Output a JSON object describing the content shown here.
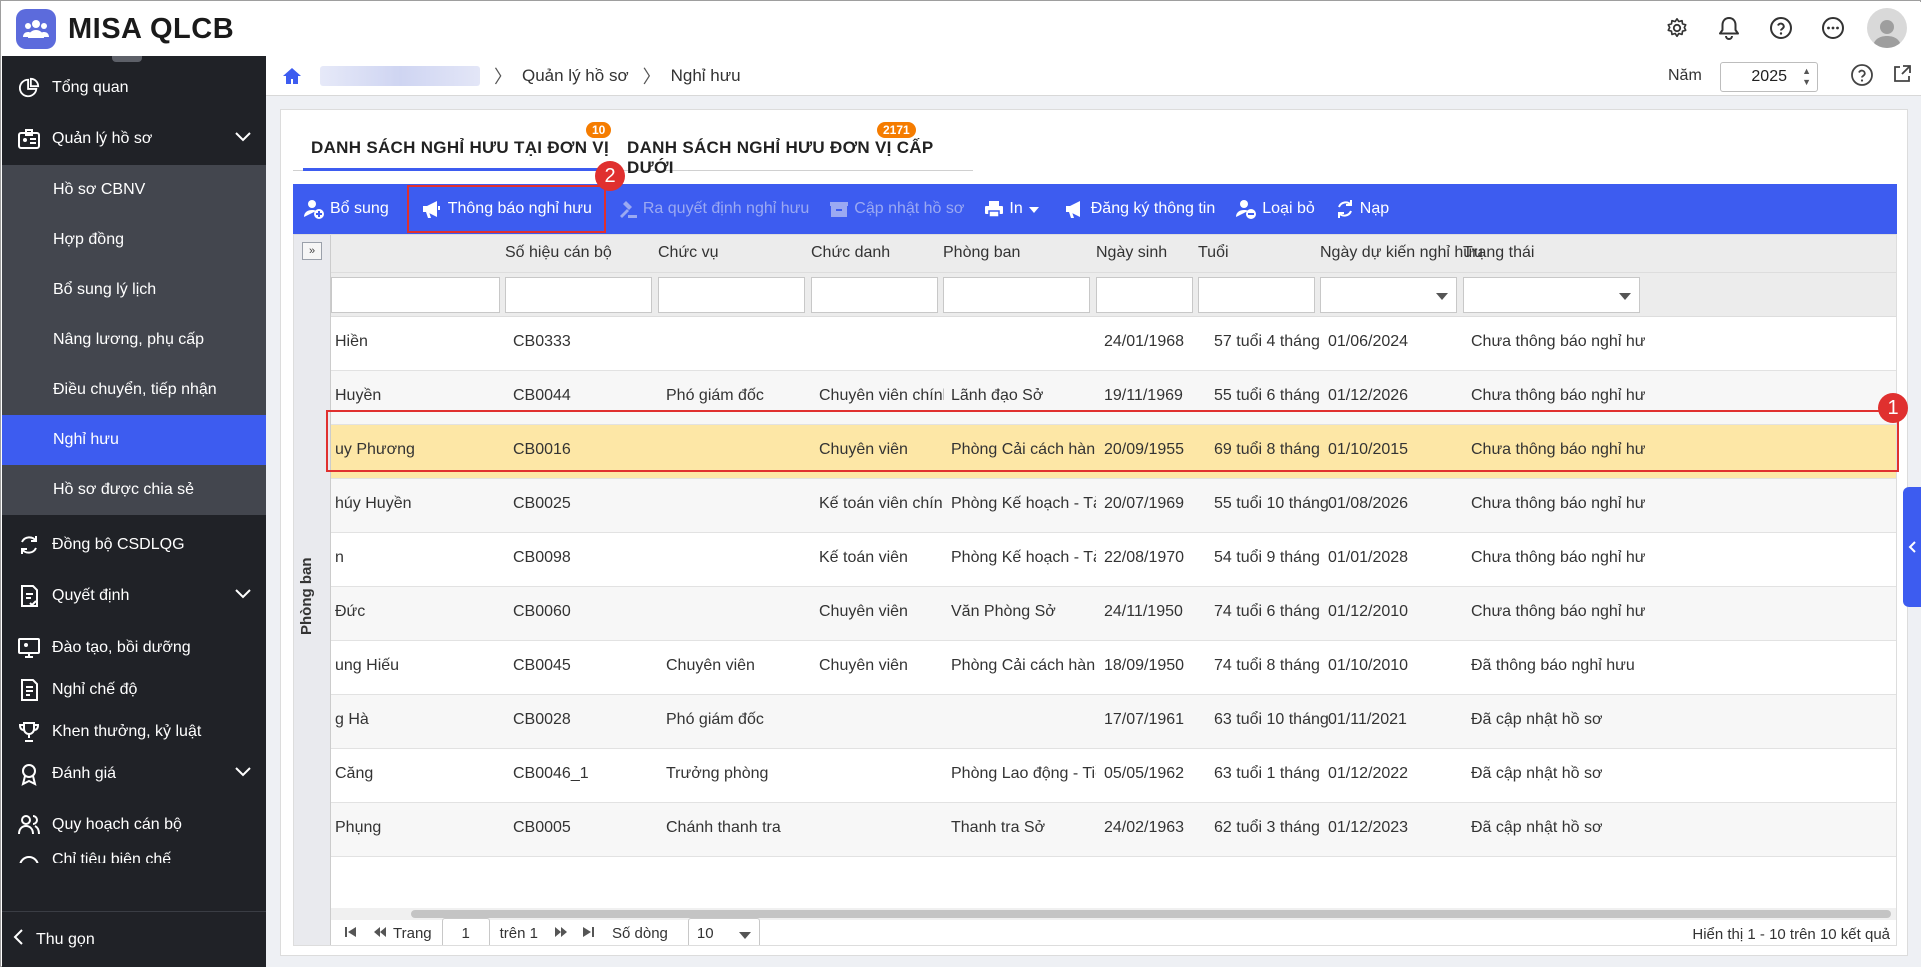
{
  "app": {
    "name": "MISA QLCB"
  },
  "topbar": {
    "icons": [
      "settings-icon",
      "bell-icon",
      "help-icon",
      "more-icon",
      "user-avatar"
    ]
  },
  "sidebar": {
    "items": [
      {
        "label": "Tổng quan",
        "icon": "pie-chart-icon"
      },
      {
        "label": "Quản lý hồ sơ",
        "icon": "profile-icon",
        "expanded": true
      },
      {
        "label": "Đồng bộ CSDLQG",
        "icon": "sync-icon"
      },
      {
        "label": "Quyết định",
        "icon": "decision-icon"
      },
      {
        "label": "Đào tạo, bồi dưỡng",
        "icon": "training-icon"
      },
      {
        "label": "Nghỉ chế độ",
        "icon": "leave-icon"
      },
      {
        "label": "Khen thưởng, kỷ luật",
        "icon": "trophy-icon"
      },
      {
        "label": "Đánh giá",
        "icon": "evaluation-icon"
      },
      {
        "label": "Quy hoạch cán bộ",
        "icon": "planning-icon"
      },
      {
        "label": "Chỉ tiêu biên chế",
        "icon": "quota-icon"
      }
    ],
    "subitems": [
      "Hồ sơ CBNV",
      "Hợp đồng",
      "Bổ sung lý lịch",
      "Nâng lương, phụ cấp",
      "Điều chuyển, tiếp nhận",
      "Nghỉ hưu",
      "Hồ sơ được chia sẻ"
    ],
    "active_subitem": "Nghỉ hưu",
    "collapse_label": "Thu gọn"
  },
  "breadcrumb": {
    "items": [
      "Quản lý hồ sơ",
      "Nghỉ hưu"
    ]
  },
  "year": {
    "label": "Năm",
    "value": "2025"
  },
  "tabs": [
    {
      "label": "DANH SÁCH NGHỈ HƯU TẠI ĐƠN VỊ",
      "badge": "10",
      "active": true
    },
    {
      "label": "DANH SÁCH NGHỈ HƯU ĐƠN VỊ CẤP DƯỚI",
      "badge": "2171",
      "active": false
    }
  ],
  "toolbar": {
    "add": "Bổ sung",
    "notify": "Thông báo nghỉ hưu",
    "decision": "Ra quyết định nghỉ hưu",
    "update": "Cập nhật hồ sơ",
    "print": "In",
    "register": "Đăng ký thông tin",
    "remove": "Loại bỏ",
    "reload": "Nạp"
  },
  "side_panel": {
    "label": "Phòng ban",
    "toggle": "»"
  },
  "table": {
    "columns": [
      "Số hiệu cán bộ",
      "Chức vụ",
      "Chức danh",
      "Phòng ban",
      "Ngày sinh",
      "Tuổi",
      "Ngày dự kiến nghỉ hưu",
      "Trạng thái"
    ],
    "rows": [
      [
        "Hiền",
        "CB0333",
        "",
        "",
        "",
        "24/01/1968",
        "57 tuổi 4 tháng",
        "01/06/2024",
        "Chưa thông báo nghỉ hưu"
      ],
      [
        "Huyền",
        "CB0044",
        "Phó giám đốc",
        "Chuyên viên chính",
        "Lãnh đạo Sở",
        "19/11/1969",
        "55 tuổi 6 tháng",
        "01/12/2026",
        "Chưa thông báo nghỉ hưu"
      ],
      [
        "uy Phương",
        "CB0016",
        "",
        "Chuyên viên",
        "Phòng Cải cách hành...",
        "20/09/1955",
        "69 tuổi 8 tháng",
        "01/10/2015",
        "Chưa thông báo nghỉ hưu"
      ],
      [
        "húy Huyền",
        "CB0025",
        "",
        "Kế toán viên chín...",
        "Phòng Kế hoạch - Tài...",
        "20/07/1969",
        "55 tuổi 10 tháng",
        "01/08/2026",
        "Chưa thông báo nghỉ hưu"
      ],
      [
        "n",
        "CB0098",
        "",
        "Kế toán viên",
        "Phòng Kế hoạch - Tài...",
        "22/08/1970",
        "54 tuổi 9 tháng",
        "01/01/2028",
        "Chưa thông báo nghỉ hưu"
      ],
      [
        "Đức",
        "CB0060",
        "",
        "Chuyên viên",
        "Văn Phòng Sở",
        "24/11/1950",
        "74 tuổi 6 tháng",
        "01/12/2010",
        "Chưa thông báo nghỉ hưu"
      ],
      [
        "ung Hiếu",
        "CB0045",
        "Chuyên viên",
        "Chuyên viên",
        "Phòng Cải cách hành...",
        "18/09/1950",
        "74 tuổi 8 tháng",
        "01/10/2010",
        "Đã thông báo nghỉ hưu"
      ],
      [
        "g Hà",
        "CB0028",
        "Phó giám đốc",
        "",
        "",
        "17/07/1961",
        "63 tuổi 10 tháng",
        "01/11/2021",
        "Đã cập nhật hồ sơ"
      ],
      [
        "Căng",
        "CB0046_1",
        "Trưởng phòng",
        "",
        "Phòng Lao động - Tiề...",
        "05/05/1962",
        "63 tuổi 1 tháng",
        "01/12/2022",
        "Đã cập nhật hồ sơ"
      ],
      [
        "Phụng",
        "CB0005",
        "Chánh thanh tra",
        "",
        "Thanh tra Sở",
        "24/02/1963",
        "62 tuổi 3 tháng",
        "01/12/2023",
        "Đã cập nhật hồ sơ"
      ]
    ],
    "selected_row": 2
  },
  "pager": {
    "page_label": "Trang",
    "page": "1",
    "of_label": "trên 1",
    "rows_label": "Số dòng",
    "rows_value": "10",
    "info": "Hiển thị 1 - 10 trên 10 kết quả"
  },
  "annotations": {
    "step1": "1",
    "step2": "2"
  },
  "colors": {
    "primary": "#3d5cf0",
    "sidebar": "#202227",
    "highlight": "#e0302f",
    "selected_row": "#fde7a6",
    "badge": "#f57c00"
  }
}
